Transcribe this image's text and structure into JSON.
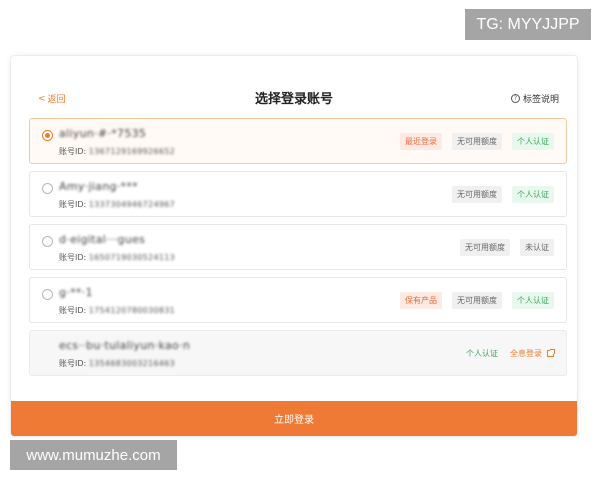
{
  "watermarks": {
    "top_right": "TG: MYYJJPP",
    "bottom_left": "www.mumuzhe.com"
  },
  "header": {
    "back_label": "返回",
    "title": "选择登录账号",
    "help_label": "标签说明"
  },
  "id_prefix": "账号ID:",
  "accounts": [
    {
      "name": "aliyun·#·*7535",
      "id_value": "1367129169926652",
      "selected": true,
      "tags": [
        "最近登录",
        "无可用额度",
        "个人认证"
      ]
    },
    {
      "name": "Amy·jiang·***",
      "id_value": "1337304946724967",
      "selected": false,
      "tags": [
        "无可用额度",
        "个人认证"
      ]
    },
    {
      "name": "d·eigital···gues",
      "id_value": "1650719030524113",
      "selected": false,
      "tags": [
        "无可用额度",
        "未认证"
      ]
    },
    {
      "name": "g·**·1",
      "id_value": "1754120780030831",
      "selected": false,
      "tags": [
        "保有产品",
        "无可用额度",
        "个人认证"
      ]
    },
    {
      "name": "ecs··bu·tulaliyun·kao·n",
      "id_value": "1354683003216463",
      "selected": false,
      "disabled": true,
      "tags": [
        "个人认证",
        "全息登录"
      ]
    }
  ],
  "login_button": "立即登录",
  "colors": {
    "accent": "#ef7a35",
    "tag_orange": "#ef6a3c",
    "tag_green": "#35a853"
  }
}
